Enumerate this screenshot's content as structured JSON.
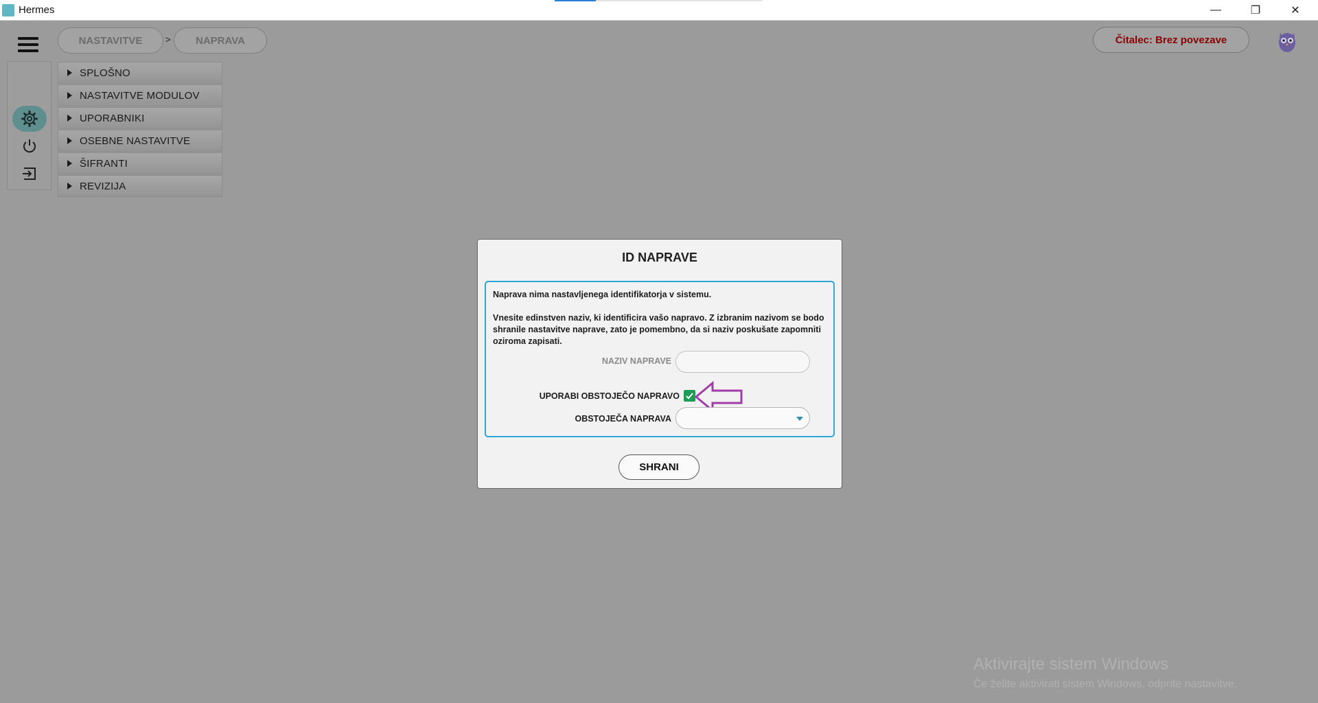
{
  "window": {
    "title": "Hermes",
    "controls": {
      "minimize": "—",
      "restore": "❐",
      "close": "✕"
    }
  },
  "header": {
    "breadcrumb": [
      "NASTAVITVE",
      "NAPRAVA"
    ],
    "breadcrumb_separator": ">",
    "reader_status": "Čitalec: Brez povezave",
    "reader_status_color": "#8b0000"
  },
  "sidebar": {
    "icons": [
      "gear-icon",
      "power-icon",
      "logout-icon"
    ],
    "active_icon": "gear-icon"
  },
  "menu": {
    "items": [
      "SPLOŠNO",
      "NASTAVITVE MODULOV",
      "UPORABNIKI",
      "OSEBNE NASTAVITVE",
      "ŠIFRANTI",
      "REVIZIJA"
    ]
  },
  "dialog": {
    "title": "ID NAPRAVE",
    "message_line1": "Naprava nima nastavljenega identifikatorja v sistemu.",
    "message_line2": "Vnesite edinstven naziv, ki identificira vašo napravo. Z izbranim nazivom se bodo shranile nastavitve naprave, zato je pomembno, da si naziv poskušate zapomniti oziroma zapisati.",
    "device_name_label": "NAZIV NAPRAVE",
    "device_name_value": "",
    "use_existing_label": "UPORABI OBSTOJEČO NAPRAVO",
    "use_existing_checked": true,
    "existing_device_label": "OBSTOJEČA NAPRAVA",
    "existing_device_value": "",
    "save_label": "SHRANI",
    "accent_color": "#2ea7d8",
    "checkbox_color": "#1e9c55",
    "annotation_arrow_color": "#a03ba8"
  },
  "watermark": {
    "line1": "Aktivirajte sistem Windows",
    "line2": "Če želite aktivirati sistem Windows, odprite nastavitve."
  }
}
